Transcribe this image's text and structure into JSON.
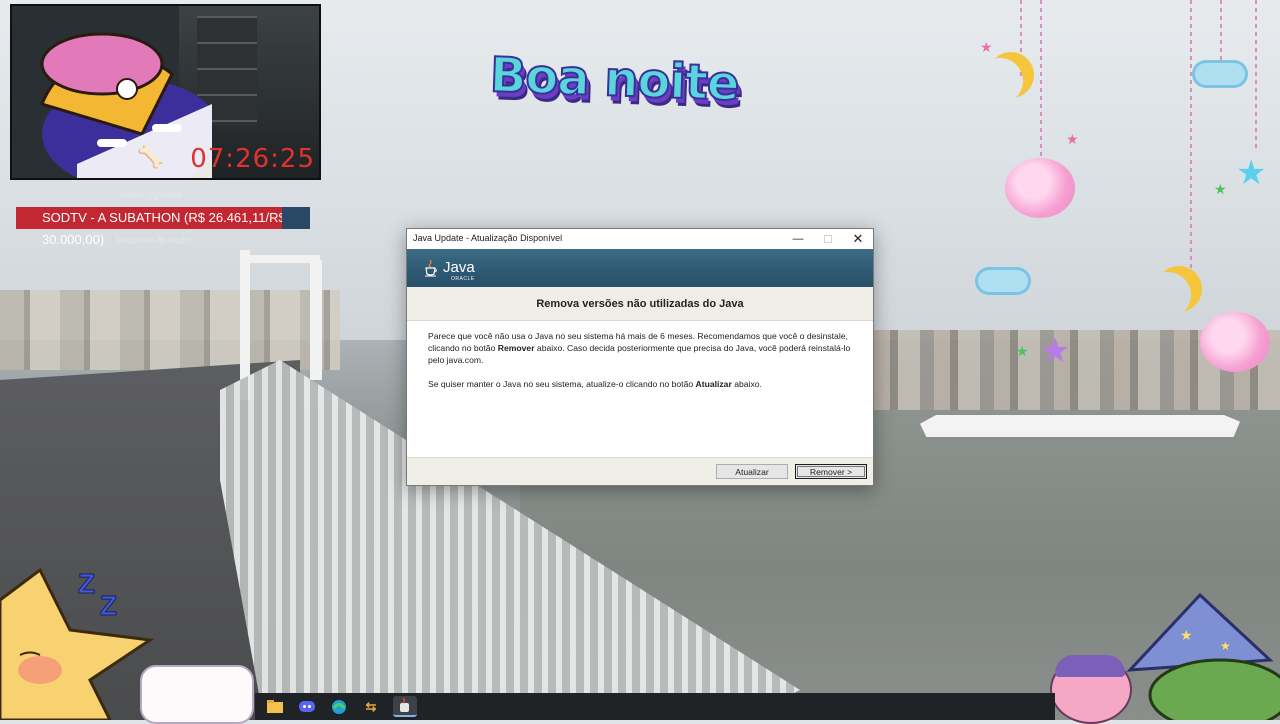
{
  "stream": {
    "timer": "07:26:25",
    "subathon_label": "SODTV - A SUBATHON (R$ 26.461,11/R$ 30.000,00)",
    "greeting": "Boa noite"
  },
  "dialog": {
    "title": "Java Update - Atualização Disponível",
    "logo_word": "Java",
    "logo_sub": "ORACLE",
    "headline": "Remova versões não utilizadas do Java",
    "p1_a": "Parece que você não usa o Java no seu sistema há mais de 6 meses. Recomendamos que você o desinstale, clicando no botão ",
    "p1_b": "Remover",
    "p1_c": " abaixo. Caso decida posteriormente que precisa do Java, você poderá reinstalá-lo pelo java.com.",
    "p2_a": "Se quiser manter o Java no seu sistema, atualize-o clicando no botão ",
    "p2_b": "Atualizar",
    "p2_c": " abaixo.",
    "update_button": "Atualizar",
    "remove_button": "Remover >"
  },
  "colors": {
    "subathon_red": "#c32732",
    "timer_red": "#e1322f",
    "java_banner": "#2f5a73"
  },
  "taskbar": {
    "icons": [
      "windows-explorer-icon",
      "discord-icon",
      "edge-icon",
      "app-arrows-icon",
      "java-update-icon"
    ]
  }
}
